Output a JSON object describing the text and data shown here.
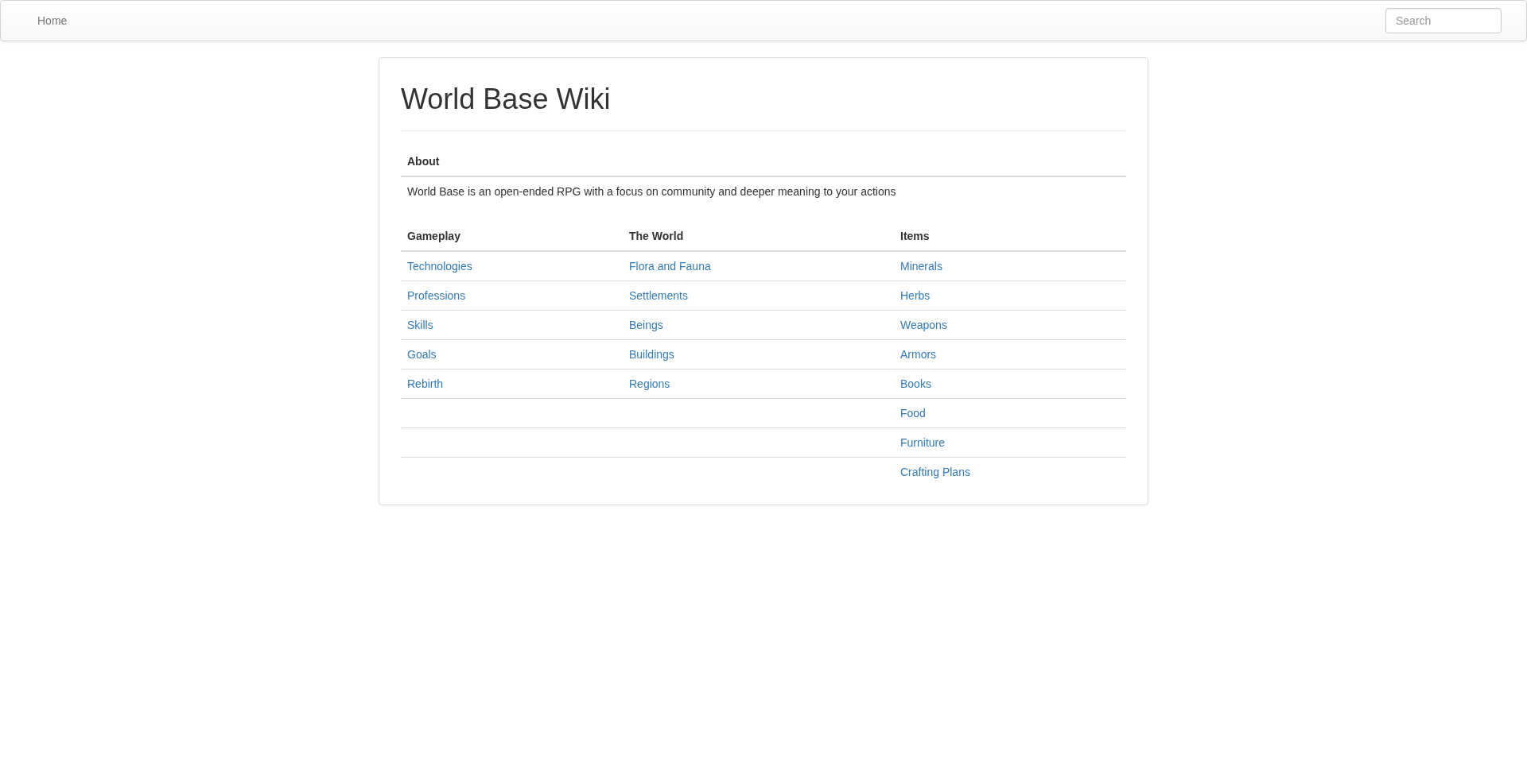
{
  "navbar": {
    "home": "Home",
    "search": {
      "placeholder": "Search"
    }
  },
  "page": {
    "title": "World Base Wiki",
    "about": {
      "heading": "About",
      "text": "World Base is an open-ended RPG with a focus on community and deeper meaning to your actions"
    },
    "sections": [
      {
        "heading": "Gameplay",
        "links": [
          "Technologies",
          "Professions",
          "Skills",
          "Goals",
          "Rebirth"
        ]
      },
      {
        "heading": "The World",
        "links": [
          "Flora and Fauna",
          "Settlements",
          "Beings",
          "Buildings",
          "Regions"
        ]
      },
      {
        "heading": "Items",
        "links": [
          "Minerals",
          "Herbs",
          "Weapons",
          "Armors",
          "Books",
          "Food",
          "Furniture",
          "Crafting Plans"
        ]
      }
    ]
  }
}
